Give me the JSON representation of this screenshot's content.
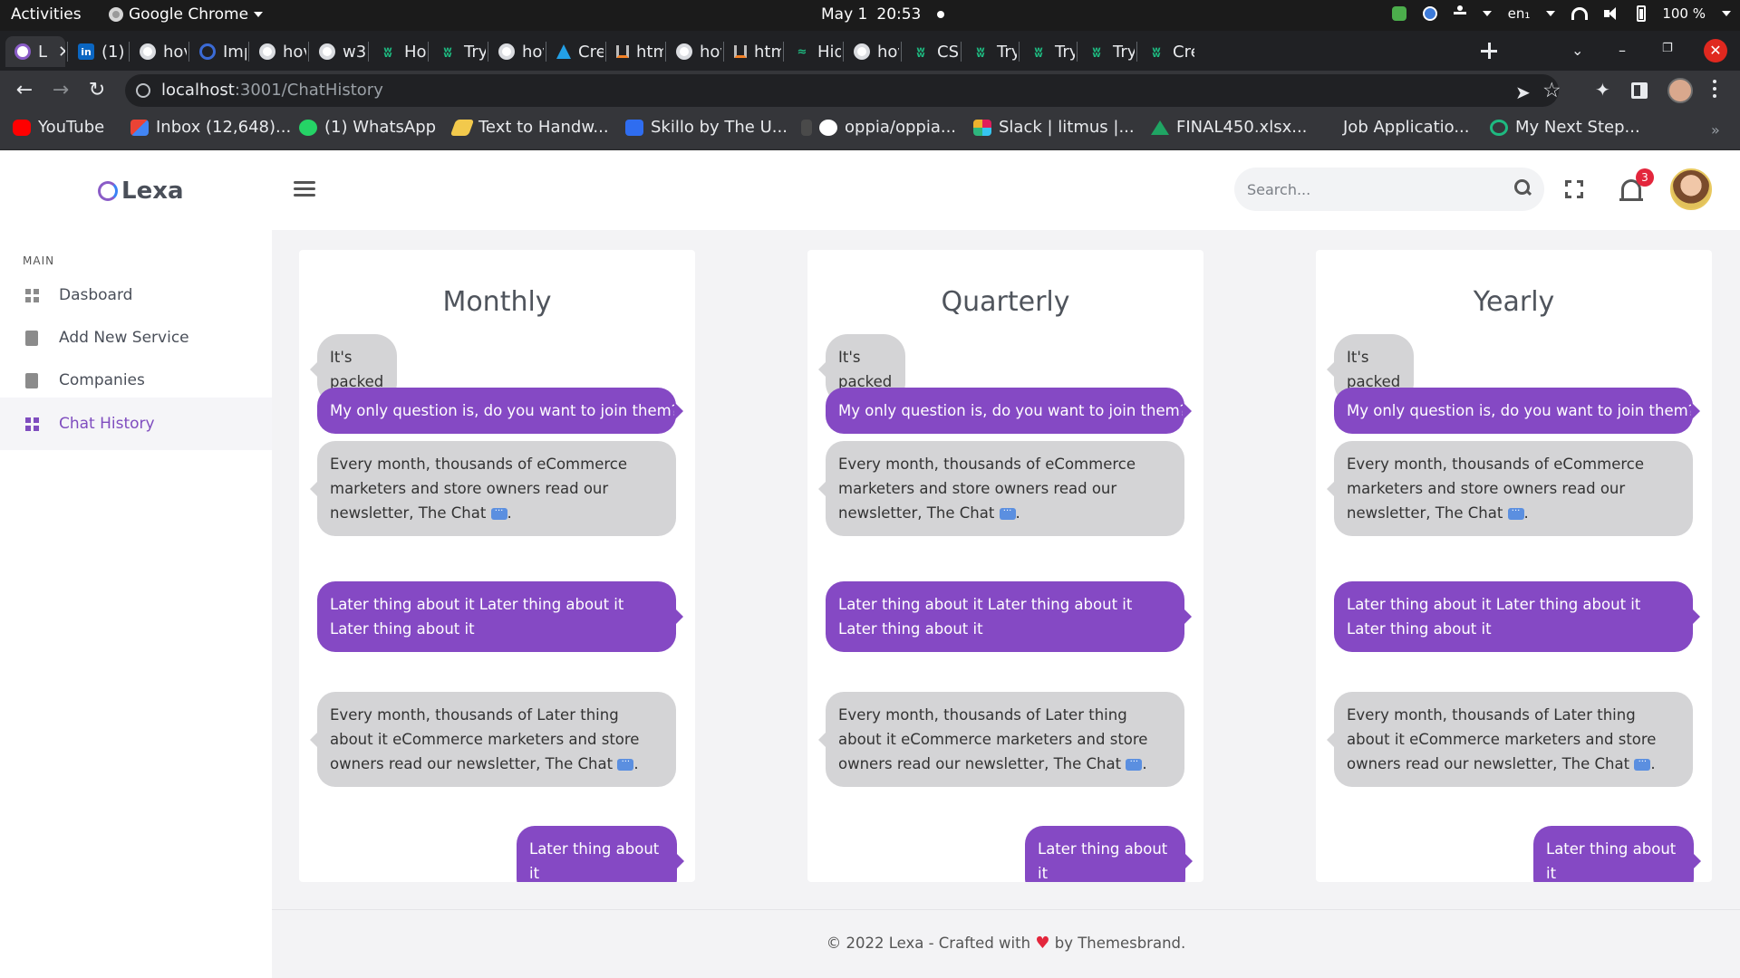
{
  "system_bar": {
    "activities": "Activities",
    "app_name": "Google Chrome",
    "date": "May 1",
    "time": "20:53",
    "lang": "en₁",
    "battery": "100 %"
  },
  "browser": {
    "tabs": [
      {
        "label": "L",
        "icon": "lexa-icon",
        "active": true
      },
      {
        "label": "(1) I",
        "icon": "linkedin-icon"
      },
      {
        "label": "hov",
        "icon": "google-icon"
      },
      {
        "label": "Imp",
        "icon": "ring-icon"
      },
      {
        "label": "hov",
        "icon": "google-icon"
      },
      {
        "label": "w3",
        "icon": "google-icon"
      },
      {
        "label": "Hov",
        "icon": "w-icon"
      },
      {
        "label": "Tryi",
        "icon": "w-icon"
      },
      {
        "label": "hov",
        "icon": "google-icon"
      },
      {
        "label": "Cre",
        "icon": "flask-icon"
      },
      {
        "label": "htm",
        "icon": "stackoverflow-icon"
      },
      {
        "label": "hov",
        "icon": "google-icon"
      },
      {
        "label": "htm",
        "icon": "stackoverflow-icon"
      },
      {
        "label": "Hid",
        "icon": "hid-icon"
      },
      {
        "label": "hov",
        "icon": "google-icon"
      },
      {
        "label": "CSS",
        "icon": "w-icon"
      },
      {
        "label": "Tryi",
        "icon": "w-icon"
      },
      {
        "label": "Tryi",
        "icon": "w-icon"
      },
      {
        "label": "Tryi",
        "icon": "w-icon"
      },
      {
        "label": "Cre",
        "icon": "w-icon"
      }
    ],
    "url_host": "localhost",
    "url_path": ":3001/ChatHistory",
    "bookmarks": [
      {
        "label": "YouTube",
        "icon": "youtube-icon"
      },
      {
        "label": "Inbox (12,648)...",
        "icon": "gmail-icon"
      },
      {
        "label": "(1) WhatsApp",
        "icon": "whatsapp-icon"
      },
      {
        "label": "Text to Handw...",
        "icon": "pen-icon"
      },
      {
        "label": "Skillo by The U...",
        "icon": "skillo-icon"
      },
      {
        "label": "oppia/oppia...",
        "icon": "github-icon"
      },
      {
        "label": "Slack | litmus |...",
        "icon": "slack-icon"
      },
      {
        "label": "FINAL450.xlsx...",
        "icon": "drive-icon"
      },
      {
        "label": "Job Applicatio...",
        "icon": "none"
      },
      {
        "label": "My Next Step...",
        "icon": "mynextstep-icon"
      }
    ],
    "bookmarks_more": "»"
  },
  "header": {
    "logo": "Lexa",
    "search_placeholder": "Search...",
    "notification_count": "3"
  },
  "sidebar": {
    "section": "MAIN",
    "items": [
      {
        "label": "Dasboard",
        "icon": "grid-icon",
        "active": false
      },
      {
        "label": "Add New Service",
        "icon": "document-icon",
        "active": false
      },
      {
        "label": "Companies",
        "icon": "document-icon",
        "active": false
      },
      {
        "label": "Chat History",
        "icon": "grid-icon",
        "active": true
      }
    ]
  },
  "chat_cards": [
    {
      "title": "Monthly",
      "messages": [
        {
          "dir": "in",
          "text": "It's packed"
        },
        {
          "dir": "out",
          "text": "My only question is, do you want to join them?"
        },
        {
          "dir": "in",
          "text": "Every month, thousands of eCommerce marketers and store owners read our newsletter, The Chat",
          "tail": "."
        },
        {
          "dir": "out",
          "text": "Later thing about it Later thing about it Later thing about it"
        },
        {
          "dir": "in",
          "text": "Every month, thousands of Later thing about it eCommerce marketers and store owners read our newsletter, The Chat",
          "tail": "."
        },
        {
          "dir": "out",
          "text": "Later thing about it"
        }
      ]
    },
    {
      "title": "Quarterly",
      "messages": [
        {
          "dir": "in",
          "text": "It's packed"
        },
        {
          "dir": "out",
          "text": "My only question is, do you want to join them?"
        },
        {
          "dir": "in",
          "text": "Every month, thousands of eCommerce marketers and store owners read our newsletter, The Chat",
          "tail": "."
        },
        {
          "dir": "out",
          "text": "Later thing about it Later thing about it Later thing about it"
        },
        {
          "dir": "in",
          "text": "Every month, thousands of Later thing about it eCommerce marketers and store owners read our newsletter, The Chat",
          "tail": "."
        },
        {
          "dir": "out",
          "text": "Later thing about it"
        }
      ]
    },
    {
      "title": "Yearly",
      "messages": [
        {
          "dir": "in",
          "text": "It's packed"
        },
        {
          "dir": "out",
          "text": "My only question is, do you want to join them?"
        },
        {
          "dir": "in",
          "text": "Every month, thousands of eCommerce marketers and store owners read our newsletter, The Chat",
          "tail": "."
        },
        {
          "dir": "out",
          "text": "Later thing about it Later thing about it Later thing about it"
        },
        {
          "dir": "in",
          "text": "Every month, thousands of Later thing about it eCommerce marketers and store owners read our newsletter, The Chat",
          "tail": "."
        },
        {
          "dir": "out",
          "text": "Later thing about it"
        }
      ]
    }
  ],
  "footer": {
    "prefix": "© 2022 Lexa - Crafted with",
    "suffix": "by Themesbrand."
  },
  "colors": {
    "accent": "#8549c4",
    "incoming_bubble": "#d4d4d6",
    "badge": "#e3263c"
  }
}
